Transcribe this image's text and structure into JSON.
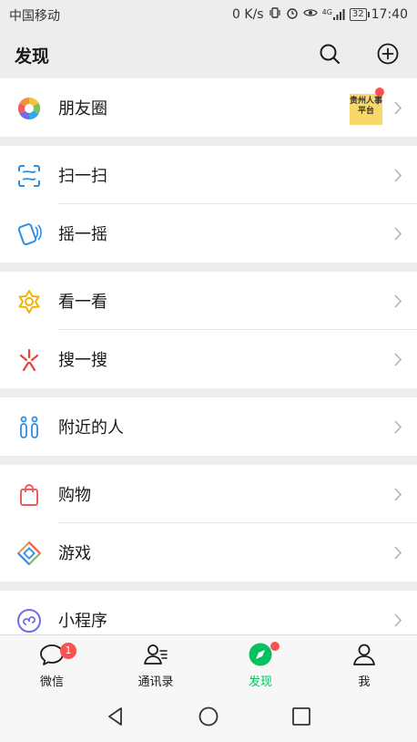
{
  "status_bar": {
    "carrier": "中国移动",
    "speed": "0 K/s",
    "network": "4G",
    "battery": "32",
    "time": "17:40"
  },
  "header": {
    "title": "发现"
  },
  "groups": [
    {
      "items": [
        {
          "label": "朋友圈",
          "thumb_text": "贵州人事平台"
        }
      ]
    },
    {
      "items": [
        {
          "label": "扫一扫"
        },
        {
          "label": "摇一摇"
        }
      ]
    },
    {
      "items": [
        {
          "label": "看一看"
        },
        {
          "label": "搜一搜"
        }
      ]
    },
    {
      "items": [
        {
          "label": "附近的人"
        }
      ]
    },
    {
      "items": [
        {
          "label": "购物"
        },
        {
          "label": "游戏"
        }
      ]
    },
    {
      "items": [
        {
          "label": "小程序"
        }
      ]
    }
  ],
  "tabbar": {
    "tabs": [
      {
        "label": "微信",
        "badge": "1"
      },
      {
        "label": "通讯录"
      },
      {
        "label": "发现"
      },
      {
        "label": "我"
      }
    ],
    "active": "发现"
  },
  "colors": {
    "accent": "#07c160",
    "badge": "#fa5151",
    "background": "#ededed"
  }
}
